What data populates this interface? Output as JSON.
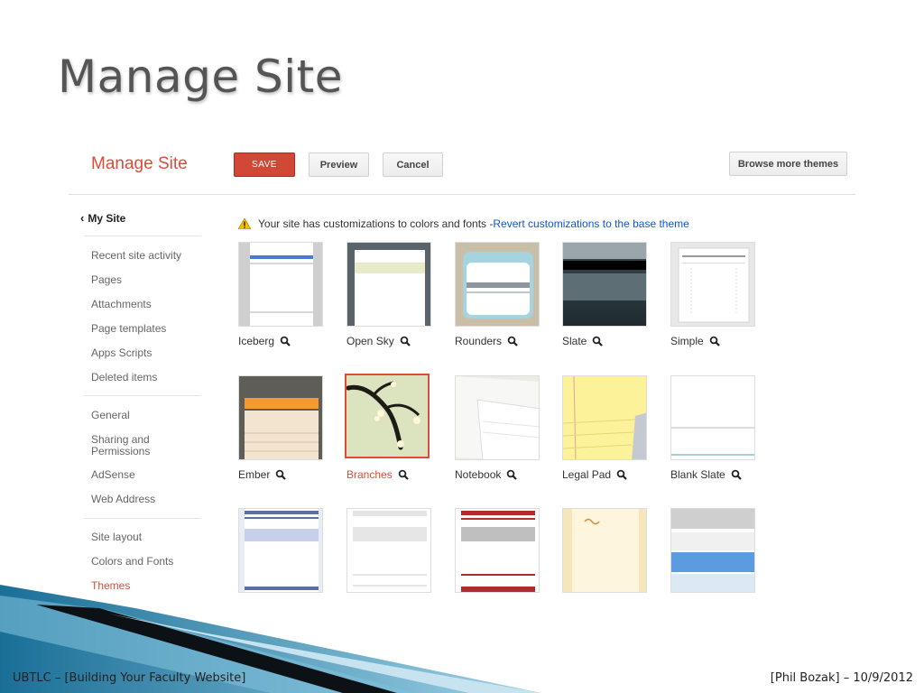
{
  "slide": {
    "title": "Manage Site",
    "footer_left": "UBTLC –  [Building Your Faculty Website]",
    "footer_right": "[Phil Bozak] – 10/9/2012"
  },
  "app": {
    "title": "Manage Site",
    "buttons": {
      "save": "SAVE",
      "preview": "Preview",
      "cancel": "Cancel",
      "browse": "Browse more themes"
    }
  },
  "sidebar": {
    "back": "My Site",
    "groups": [
      [
        "Recent site activity",
        "Pages",
        "Attachments",
        "Page templates",
        "Apps Scripts",
        "Deleted items"
      ],
      [
        "General",
        "Sharing and Permissions",
        "AdSense",
        "Web Address"
      ],
      [
        "Site layout",
        "Colors and Fonts",
        "Themes"
      ]
    ],
    "active": "Themes"
  },
  "notice": {
    "text": "Your site has customizations to colors and fonts - ",
    "link": "Revert customizations to the base theme"
  },
  "themes": {
    "selected": "Branches",
    "row1": [
      "Iceberg",
      "Open Sky",
      "Rounders",
      "Slate",
      "Simple"
    ],
    "row2": [
      "Ember",
      "Branches",
      "Notebook",
      "Legal Pad",
      "Blank Slate"
    ]
  },
  "colors": {
    "accent": "#dd4b39",
    "link": "#1155cc"
  }
}
